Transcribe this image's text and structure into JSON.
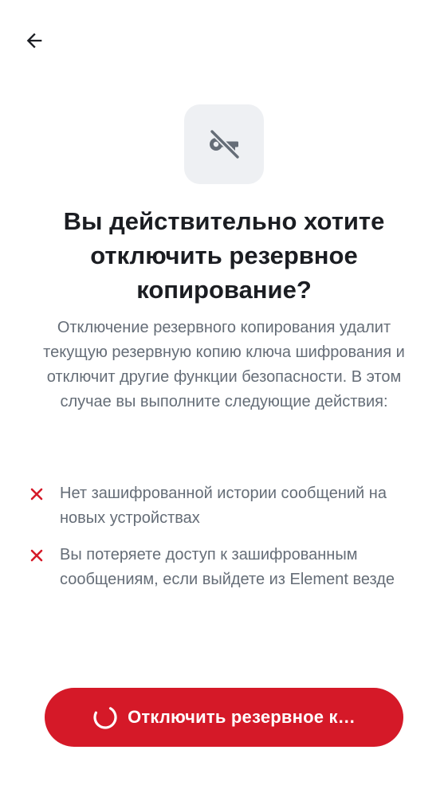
{
  "header": {
    "back_icon": "arrow-left-icon"
  },
  "hero": {
    "icon": "key-off-icon"
  },
  "dialog": {
    "title": "Вы действительно хотите отключить резервное копирование?",
    "description": "Отключение резервного копирования удалит текущую резервную копию ключа шифрования и отключит другие функции безопасности. В этом случае вы выполните следующие действия:"
  },
  "consequences": [
    {
      "icon": "close-icon",
      "text": "Нет зашифрованной истории сообщений на новых устройствах"
    },
    {
      "icon": "close-icon",
      "text": "Вы потеряете доступ к зашифрованным сообщениям, если выйдете из Element везде"
    }
  ],
  "confirm_button": {
    "label": "Отключить резервное к…",
    "state": "loading",
    "icon": "spinner-icon"
  },
  "colors": {
    "destructive": "#d51928",
    "text_primary": "#1b1d22",
    "text_secondary": "#656d77",
    "icon_bg": "#eef0f3"
  }
}
